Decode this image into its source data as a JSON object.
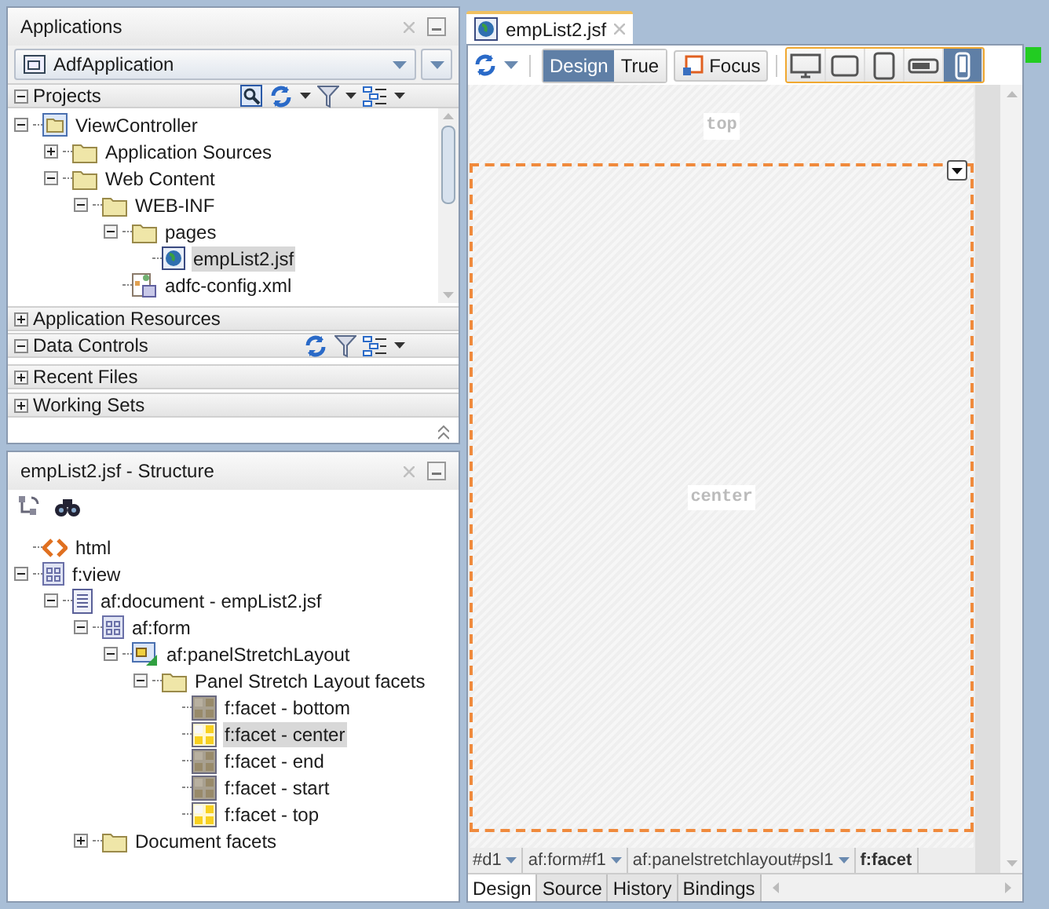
{
  "applications": {
    "title": "Applications",
    "app_selector": "AdfApplication",
    "sections": [
      {
        "label": "Projects",
        "expanded": true
      },
      {
        "label": "Application Resources",
        "expanded": false
      },
      {
        "label": "Data Controls",
        "expanded": true
      },
      {
        "label": "Recent Files",
        "expanded": false
      },
      {
        "label": "Working Sets",
        "expanded": false
      }
    ],
    "project_tree": [
      {
        "label": "ViewController",
        "kind": "project",
        "expanded": true,
        "selected": false,
        "children": [
          {
            "label": "Application Sources",
            "kind": "folder",
            "expanded": false,
            "selected": false
          },
          {
            "label": "Web Content",
            "kind": "folder",
            "expanded": true,
            "selected": false,
            "children": [
              {
                "label": "WEB-INF",
                "kind": "folder",
                "expanded": true,
                "selected": false,
                "children": [
                  {
                    "label": "pages",
                    "kind": "folder",
                    "expanded": true,
                    "selected": false,
                    "children": [
                      {
                        "label": "empList2.jsf",
                        "kind": "page",
                        "selected": true
                      }
                    ]
                  },
                  {
                    "label": "adfc-config.xml",
                    "kind": "config",
                    "selected": false
                  }
                ]
              }
            ]
          }
        ]
      }
    ]
  },
  "structure": {
    "title": "empList2.jsf - Structure",
    "tree": [
      {
        "label": "html",
        "kind": "html",
        "selected": false
      },
      {
        "label": "f:view",
        "kind": "view",
        "expanded": true,
        "selected": false,
        "children": [
          {
            "label": "af:document - empList2.jsf",
            "kind": "document",
            "expanded": true,
            "selected": false,
            "children": [
              {
                "label": "af:form",
                "kind": "view",
                "expanded": true,
                "selected": false,
                "children": [
                  {
                    "label": "af:panelStretchLayout",
                    "kind": "layout",
                    "expanded": true,
                    "selected": false,
                    "children": [
                      {
                        "label": "Panel Stretch Layout facets",
                        "kind": "folder",
                        "expanded": true,
                        "selected": false,
                        "children": [
                          {
                            "label": "f:facet - bottom",
                            "kind": "facet",
                            "selected": false
                          },
                          {
                            "label": "f:facet - center",
                            "kind": "facet_filled",
                            "selected": true
                          },
                          {
                            "label": "f:facet - end",
                            "kind": "facet",
                            "selected": false
                          },
                          {
                            "label": "f:facet - start",
                            "kind": "facet",
                            "selected": false
                          },
                          {
                            "label": "f:facet - top",
                            "kind": "facet_filled",
                            "selected": false
                          }
                        ]
                      }
                    ]
                  }
                ]
              },
              {
                "label": "Document facets",
                "kind": "folder",
                "expanded": false,
                "selected": false
              }
            ]
          }
        ]
      }
    ]
  },
  "editor": {
    "tab": "empList2.jsf",
    "modes": [
      {
        "label": "Design",
        "selected": true
      },
      {
        "label": "True",
        "selected": false
      }
    ],
    "focus_button": "Focus",
    "devices": [
      {
        "kind": "desktop",
        "selected": false
      },
      {
        "kind": "tablet_landscape",
        "selected": false
      },
      {
        "kind": "tablet_portrait",
        "selected": false
      },
      {
        "kind": "phone_landscape",
        "selected": false
      },
      {
        "kind": "phone_portrait",
        "selected": true
      }
    ],
    "facet_labels": {
      "top": "top",
      "center": "center"
    },
    "breadcrumbs": [
      {
        "label": "#d1",
        "current": false
      },
      {
        "label": "af:form#f1",
        "current": false
      },
      {
        "label": "af:panelstretchlayout#psl1",
        "current": false
      },
      {
        "label": "f:facet",
        "current": true
      }
    ],
    "bottom_tabs": [
      {
        "label": "Design",
        "selected": true
      },
      {
        "label": "Source",
        "selected": false
      },
      {
        "label": "History",
        "selected": false
      },
      {
        "label": "Bindings",
        "selected": false
      }
    ]
  }
}
